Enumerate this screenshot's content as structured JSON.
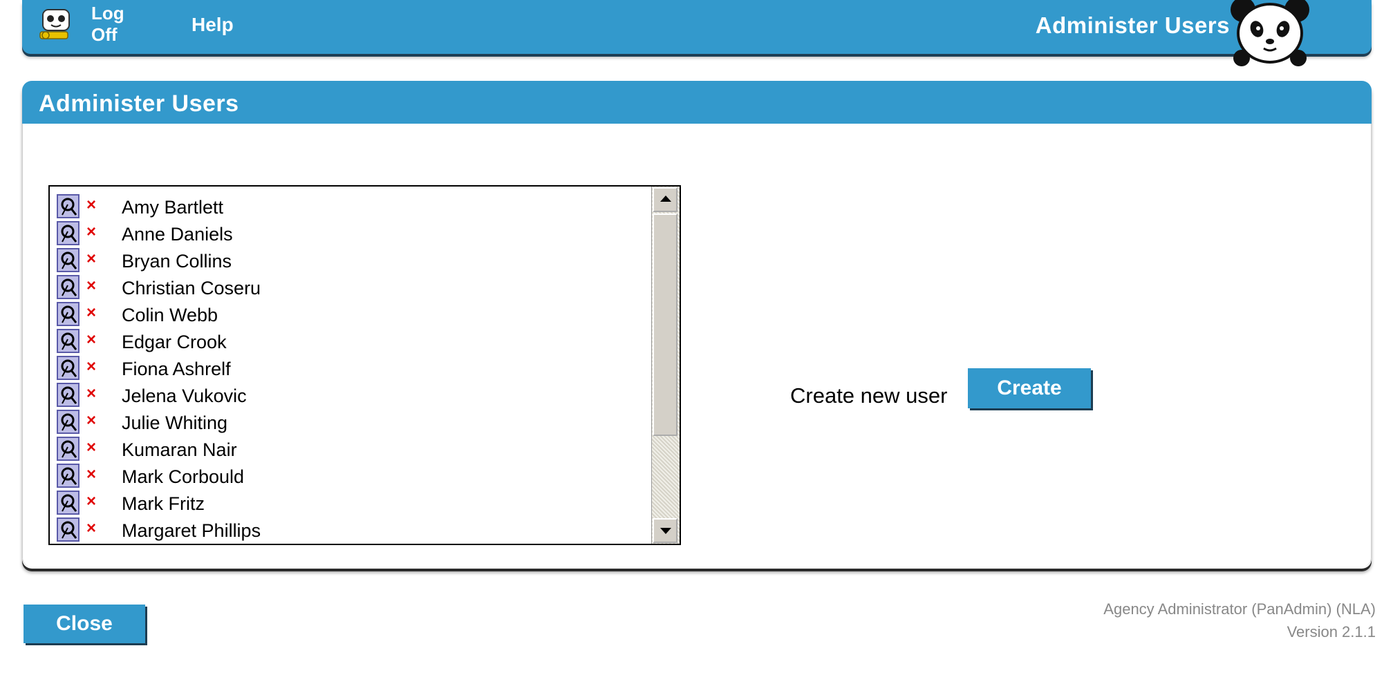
{
  "topbar": {
    "logoff_label": "Log Off",
    "help_label": "Help",
    "title": "Administer Users"
  },
  "panel": {
    "title": "Administer Users"
  },
  "users": [
    {
      "name": "Amy Bartlett"
    },
    {
      "name": "Anne Daniels"
    },
    {
      "name": "Bryan Collins"
    },
    {
      "name": "Christian Coseru"
    },
    {
      "name": "Colin Webb"
    },
    {
      "name": "Edgar Crook"
    },
    {
      "name": "Fiona Ashrelf"
    },
    {
      "name": "Jelena Vukovic"
    },
    {
      "name": "Julie Whiting"
    },
    {
      "name": "Kumaran Nair"
    },
    {
      "name": "Mark Corbould"
    },
    {
      "name": "Mark Fritz"
    },
    {
      "name": "Margaret Phillips"
    }
  ],
  "row_icons": {
    "edit": "edit-icon",
    "delete": "delete-icon",
    "delete_glyph": "×"
  },
  "create": {
    "label": "Create new user",
    "button_label": "Create"
  },
  "close_label": "Close",
  "footer": {
    "role": "Agency Administrator (PanAdmin) (NLA)",
    "version": "Version 2.1.1"
  },
  "colors": {
    "accent": "#3399cc",
    "delete_red": "#e00000"
  }
}
